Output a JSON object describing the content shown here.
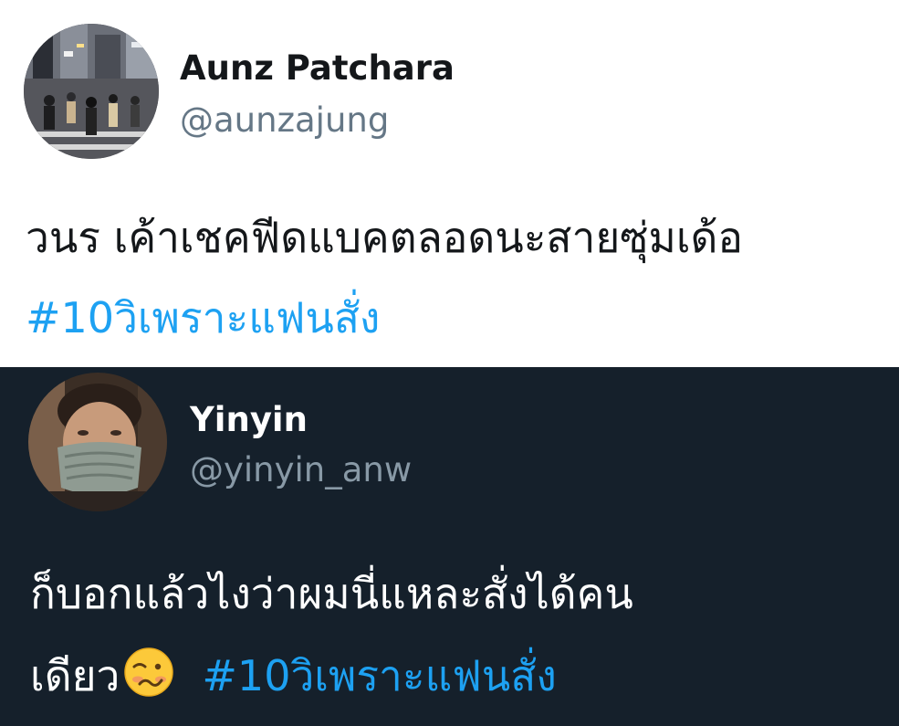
{
  "tweets": [
    {
      "author_name": "Aunz Patchara",
      "author_handle": "@aunzajung",
      "text_line": "วนร เค้าเชคฟีดแบคตลอดนะสายซุ่มเด้อ",
      "hashtag": "#10วิเพราะแฟนสั่ง",
      "avatar_icon": "street-crowd-avatar",
      "theme": "light"
    },
    {
      "author_name": "Yinyin",
      "author_handle": "@yinyin_anw",
      "text_line": "ก็บอกแล้วไงว่าผมนี่แหละสั่งได้คน",
      "text_continuation": "เดียว",
      "emoji_icon": "woozy-face-emoji",
      "hashtag": "#10วิเพราะแฟนสั่ง",
      "avatar_icon": "masked-person-avatar",
      "theme": "dark"
    }
  ],
  "colors": {
    "light_bg": "#ffffff",
    "dark_bg": "#15202b",
    "link_blue": "#1da1f2",
    "light_text": "#14171a",
    "light_secondary": "#657786",
    "dark_secondary": "#8899a6"
  }
}
